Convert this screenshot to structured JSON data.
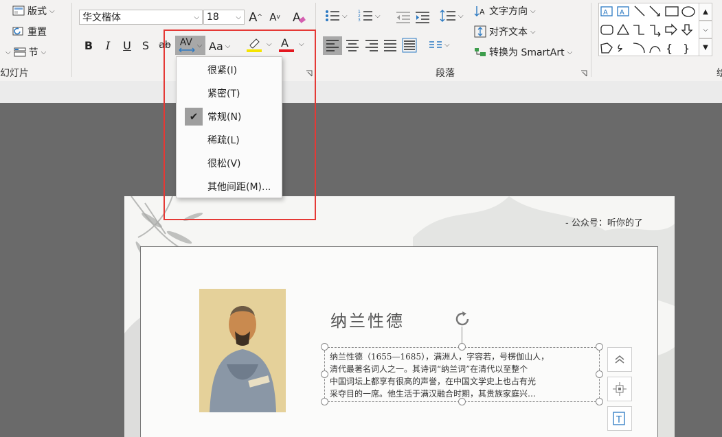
{
  "ribbon": {
    "slides_group": {
      "layout_label": "版式",
      "reset_label": "重置",
      "section_label": "节",
      "group_label": "幻灯片"
    },
    "font_group": {
      "font_name": "华文楷体",
      "font_size": "18",
      "bold": "B",
      "italic": "I",
      "underline": "U",
      "shadow": "S",
      "strike": "ab",
      "spacing": "AV",
      "case": "Aa",
      "font_color_letter": "A",
      "grow": "A",
      "shrink": "A"
    },
    "paragraph_group": {
      "text_direction_label": "文字方向",
      "align_text_label": "对齐文本",
      "smartart_label": "转换为 SmartArt",
      "group_label": "段落"
    },
    "drawing_group": {
      "group_label": "绘"
    },
    "colors": {
      "highlight_bar": "#f5e400",
      "font_color_bar": "#e3171f"
    }
  },
  "spacing_menu": {
    "items": [
      {
        "label": "很紧(I)",
        "checked": false
      },
      {
        "label": "紧密(T)",
        "checked": false
      },
      {
        "label": "常规(N)",
        "checked": true
      },
      {
        "label": "稀疏(L)",
        "checked": false
      },
      {
        "label": "很松(V)",
        "checked": false
      },
      {
        "label": "其他间距(M)...",
        "checked": false
      }
    ]
  },
  "slide": {
    "header_text": "-  公众号：听你的了",
    "title": "纳兰性德",
    "body_lines": [
      "纳兰性德（1655—1685），满洲人，字容若，号楞伽山人，",
      "清代最著名词人之一。其诗词“纳兰词”在清代以至整个",
      "中国词坛上都享有很高的声誉，在中国文学史上也占有光",
      "采夺目的一席。他生活于满汉融合时期，其贵族家庭兴…"
    ]
  },
  "highlight_color": "#e53935"
}
